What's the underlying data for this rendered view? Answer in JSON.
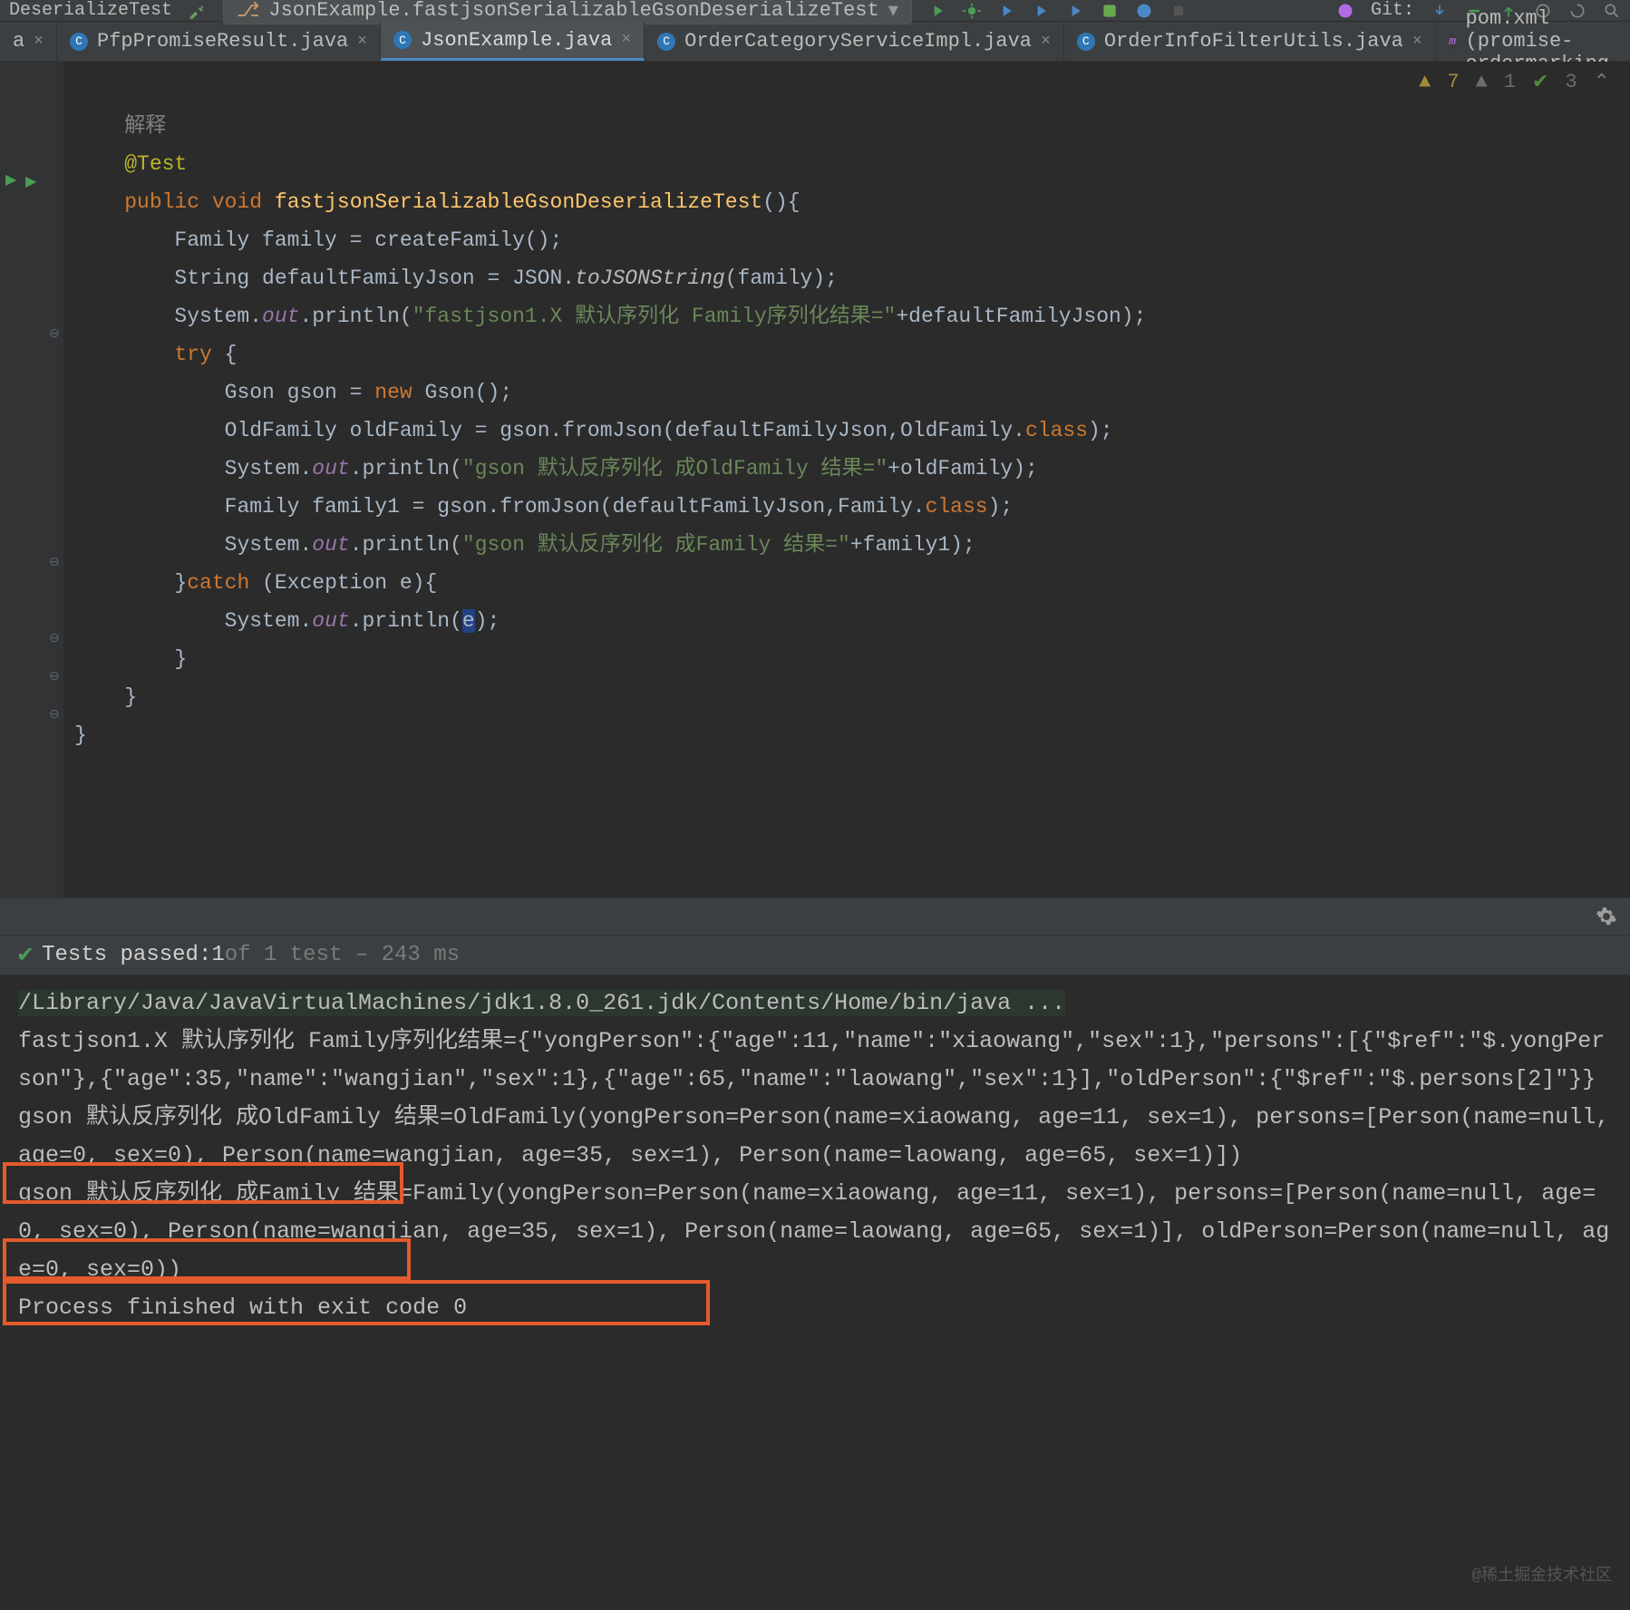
{
  "toolbar": {
    "run_config_left": "DeserializeTest",
    "run_config_dropdown": "JsonExample.fastjsonSerializableGsonDeserializeTest",
    "git_label": "Git:"
  },
  "tabs": [
    {
      "label": "a",
      "active": false,
      "type": "java"
    },
    {
      "label": "PfpPromiseResult.java",
      "active": false,
      "type": "java"
    },
    {
      "label": "JsonExample.java",
      "active": true,
      "type": "java"
    },
    {
      "label": "OrderCategoryServiceImpl.java",
      "active": false,
      "type": "java"
    },
    {
      "label": "OrderInfoFilterUtils.java",
      "active": false,
      "type": "java"
    },
    {
      "label": "pom.xml (promise-ordermarking",
      "active": false,
      "type": "maven"
    }
  ],
  "inspection": {
    "warnings": "7",
    "typos": "1",
    "ok": "3"
  },
  "code": {
    "c1": "解释",
    "c2": "@Test",
    "c3_public": "public",
    "c3_void": "void",
    "c3_name": "fastjsonSerializableGsonDeserializeTest",
    "c4": "Family family = createFamily();",
    "c5_a": "String defaultFamilyJson = JSON.",
    "c5_b": "toJSONString",
    "c5_c": "(family);",
    "c6_a": "System.",
    "c6_b": "out",
    "c6_c": ".println(",
    "c6_d": "\"fastjson1.X 默认序列化 Family序列化结果=\"",
    "c6_e": "+defaultFamilyJson);",
    "c7_try": "try",
    "c7_brace": " {",
    "c8_a": "Gson gson = ",
    "c8_new": "new",
    "c8_b": " Gson();",
    "c9": "OldFamily oldFamily = gson.fromJson(defaultFamilyJson,OldFamily.",
    "c9_cls": "class",
    "c9_tail": ");",
    "c10_a": "System.",
    "c10_b": "out",
    "c10_c": ".println(",
    "c10_d": "\"gson 默认反序列化 成OldFamily 结果=\"",
    "c10_e": "+oldFamily);",
    "c11": "Family family1 = gson.fromJson(defaultFamilyJson,Family.",
    "c11_cls": "class",
    "c11_tail": ");",
    "c12_a": "System.",
    "c12_b": "out",
    "c12_c": ".println(",
    "c12_d": "\"gson 默认反序列化 成Family 结果=\"",
    "c12_e": "+family1);",
    "c13_a": "}",
    "c13_catch": "catch",
    "c13_b": " (Exception e){",
    "c14_a": "System.",
    "c14_b": "out",
    "c14_c": ".println(",
    "c14_d": "e",
    "c14_e": ");",
    "c15": "}",
    "c16": "}",
    "c17": "}"
  },
  "tests": {
    "passed_label": "Tests passed: ",
    "passed_count": "1",
    "total_label": " of 1 test – 243 ms"
  },
  "console": {
    "cmd": "/Library/Java/JavaVirtualMachines/jdk1.8.0_261.jdk/Contents/Home/bin/java ...",
    "line1": "fastjson1.X 默认序列化 Family序列化结果={\"yongPerson\":{\"age\":11,\"name\":\"xiaowang\",\"sex\":1},\"persons\":[{\"$ref\":\"$.yongPerson\"},{\"age\":35,\"name\":\"wangjian\",\"sex\":1},{\"age\":65,\"name\":\"laowang\",\"sex\":1}],\"oldPerson\":{\"$ref\":\"$.persons[2]\"}}",
    "line2": "gson 默认反序列化 成OldFamily 结果=OldFamily(yongPerson=Person(name=xiaowang, age=11, sex=1), persons=[Person(name=null, age=0, sex=0), Person(name=wangjian, age=35, sex=1), Person(name=laowang, age=65, sex=1)])",
    "line3": "gson 默认反序列化 成Family 结果=Family(yongPerson=Person(name=xiaowang, age=11, sex=1), persons=[Person(name=null, age=0, sex=0), Person(name=wangjian, age=35, sex=1), Person(name=laowang, age=65, sex=1)], oldPerson=Person(name=null, age=0, sex=0))",
    "blank": "",
    "exit": "Process finished with exit code 0"
  },
  "watermark": "@稀土掘金技术社区"
}
